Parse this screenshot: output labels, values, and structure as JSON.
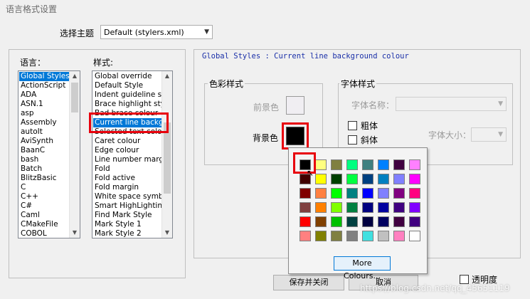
{
  "window": {
    "title": "语言格式设置"
  },
  "theme": {
    "label": "选择主题",
    "value": "Default (stylers.xml)"
  },
  "language_list": {
    "header": "语言：",
    "items": [
      "Global Styles",
      "ActionScript",
      "ADA",
      "ASN.1",
      "asp",
      "Assembly",
      "autoIt",
      "AviSynth",
      "BaanC",
      "bash",
      "Batch",
      "BlitzBasic",
      "C",
      "C++",
      "C#",
      "Caml",
      "CMakeFile",
      "COBOL"
    ],
    "selected_index": 0
  },
  "style_list": {
    "header": "样式:",
    "items": [
      "Global override",
      "Default Style",
      "Indent guideline sty",
      "Brace highlight style",
      "Bad brace colour",
      "Current line backgr",
      "Selected text colou",
      "Caret colour",
      "Edge colour",
      "Line number margin",
      "Fold",
      "Fold active",
      "Fold margin",
      "White space symbo",
      "Smart HighLighting",
      "Find Mark Style",
      "Mark Style 1",
      "Mark Style 2"
    ],
    "selected_index": 5
  },
  "description": "Global Styles : Current line background colour",
  "color_style": {
    "header": "色彩样式",
    "fg_label": "前景色",
    "bg_label": "背景色",
    "fg_color": "#f0eef2",
    "bg_color": "#000000"
  },
  "font_style": {
    "header": "字体样式",
    "name_label": "字体名称：",
    "bold_label": "粗体",
    "italic_label": "斜体",
    "size_label": "字体大小："
  },
  "palette": {
    "colors": [
      [
        "#000000",
        "#ffff80",
        "#808040",
        "#00ff80",
        "#408080",
        "#0080ff",
        "#400040",
        "#ff80ff"
      ],
      [
        "#400000",
        "#ffff00",
        "#004000",
        "#00ff40",
        "#004080",
        "#0080c0",
        "#8080ff",
        "#ff00ff"
      ],
      [
        "#800000",
        "#ff8040",
        "#00ff00",
        "#008080",
        "#0000ff",
        "#8080ff",
        "#800080",
        "#ff0080"
      ],
      [
        "#804040",
        "#ff8000",
        "#80ff00",
        "#008040",
        "#000080",
        "#0000a0",
        "#400080",
        "#8000ff"
      ],
      [
        "#ff0000",
        "#804000",
        "#00c000",
        "#004040",
        "#000040",
        "#000060",
        "#400040",
        "#400080"
      ],
      [
        "#ff8080",
        "#808000",
        "#808040",
        "#808080",
        "#40e0e0",
        "#c0c0c0",
        "#ff80c0",
        "#ffffff"
      ]
    ],
    "more_label": "More Colours..."
  },
  "transparency": {
    "label": "透明度"
  },
  "buttons": {
    "save_close": "保存并关闭",
    "cancel": "取消"
  },
  "watermark": "https://blog.csdn.net/qq_45651119"
}
